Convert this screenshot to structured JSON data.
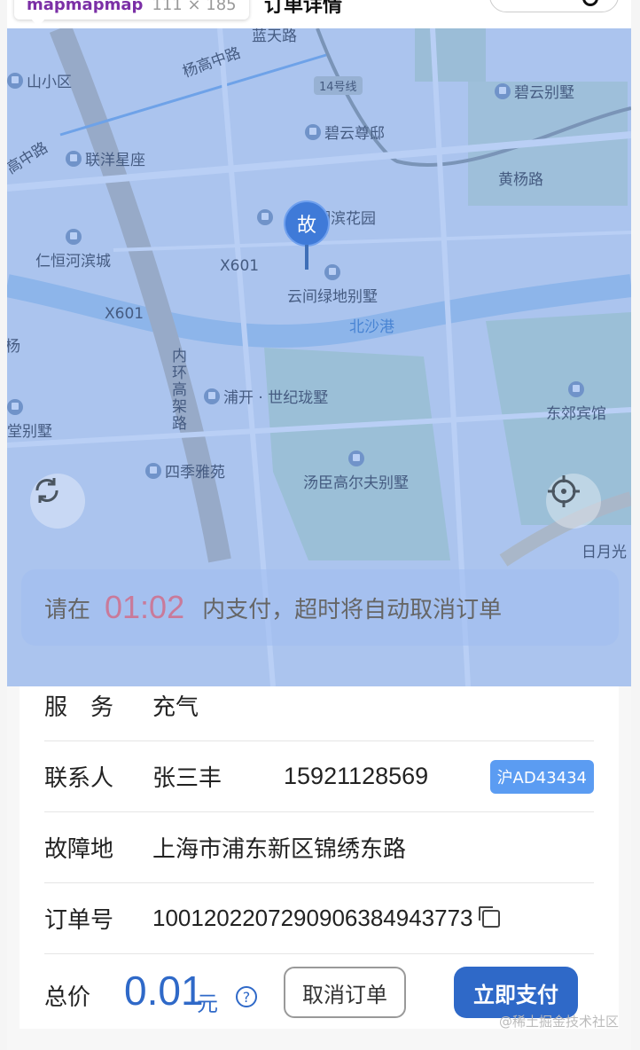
{
  "header": {
    "tooltip_brand": "mapmapmap",
    "tooltip_size": "111 × 185",
    "title": "订单详情"
  },
  "map": {
    "labels": {
      "lanjiang": "蓝天路",
      "shanxiaoqu": "山小区",
      "yanggaozhong": "杨高中路",
      "line14": "14号线",
      "biyun_villa": "碧云别墅",
      "biyun_zundi": "碧云尊邸",
      "lianyang": "联洋星座",
      "gaozhong": "高中路",
      "huangyang": "黄杨路",
      "binhe_garden": "湖滨花园",
      "renheng": "仁恒河滨城",
      "x601a": "X601",
      "yunjian": "云间绿地别墅",
      "x601b": "X601",
      "beisha": "北沙港",
      "ring_road": "内环高架路",
      "pukai": "浦开 · 世纪珑墅",
      "dongjiao": "东郊宾馆",
      "tangbie": "堂别墅",
      "siji": "四季雅苑",
      "tangchen": "汤臣高尔夫别墅",
      "riyue": "日月光",
      "yang": "杨"
    },
    "marker_text": "故"
  },
  "timer": {
    "prefix": "请在",
    "countdown": "01:02",
    "suffix": "内支付，超时将自动取消订单"
  },
  "order": {
    "service_label": "服　务",
    "service_value": "充气",
    "contact_label": "联系人",
    "contact_name": "张三丰",
    "contact_phone": "15921128569",
    "plate": "沪AD43434",
    "location_label": "故障地",
    "location_value": "上海市浦东新区锦绣东路",
    "order_no_label": "订单号",
    "order_no_value": "1001202207290906384943773"
  },
  "footer": {
    "total_label": "总价",
    "price": "0.01",
    "unit": "元",
    "help_glyph": "?",
    "cancel_label": "取消订单",
    "pay_label": "立即支付"
  },
  "watermark": "@稀土掘金技术社区",
  "colors": {
    "accent": "#2f69c8",
    "plate_bg": "#5b9cf2",
    "countdown": "#c97a9a"
  },
  "icons": [
    "refresh-icon",
    "locate-icon",
    "copy-icon",
    "help-icon",
    "poi-icon"
  ]
}
